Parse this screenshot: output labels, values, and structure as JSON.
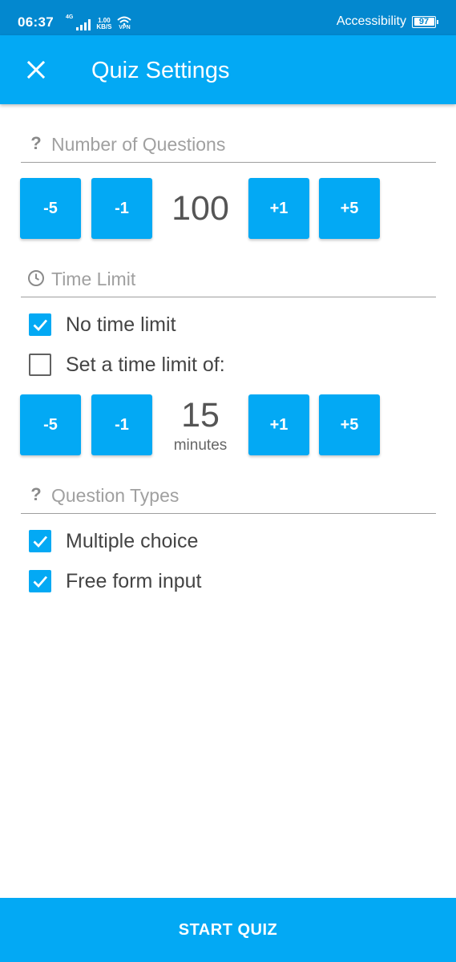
{
  "status_bar": {
    "time": "06:37",
    "network_label": "4G",
    "speed_value": "1.00",
    "speed_unit": "KB/S",
    "vpn_label": "VPN",
    "accessibility_label": "Accessibility",
    "battery": "97"
  },
  "app_bar": {
    "title": "Quiz Settings",
    "close_icon": "close-icon"
  },
  "questions": {
    "header": "Number of Questions",
    "icon": "question-mark-icon",
    "value": "100",
    "buttons": {
      "minus5": "-5",
      "minus1": "-1",
      "plus1": "+1",
      "plus5": "+5"
    }
  },
  "time_limit": {
    "header": "Time Limit",
    "icon": "clock-icon",
    "options": [
      {
        "label": "No time limit",
        "checked": true
      },
      {
        "label": "Set a time limit of:",
        "checked": false
      }
    ],
    "value": "15",
    "unit": "minutes",
    "buttons": {
      "minus5": "-5",
      "minus1": "-1",
      "plus1": "+1",
      "plus5": "+5"
    }
  },
  "question_types": {
    "header": "Question Types",
    "icon": "question-mark-icon",
    "options": [
      {
        "label": "Multiple choice",
        "checked": true
      },
      {
        "label": "Free form input",
        "checked": true
      }
    ]
  },
  "start_button": "START QUIZ",
  "colors": {
    "primary": "#03a9f4",
    "status_bar": "#0388cf",
    "text": "#444444",
    "muted": "#a0a0a0"
  }
}
